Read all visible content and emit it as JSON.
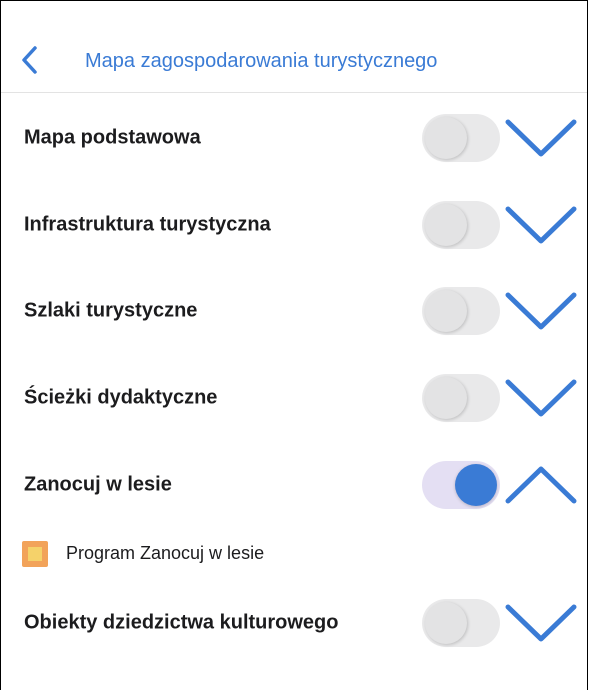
{
  "header": {
    "back_icon": "chevron-left-icon",
    "title": "Mapa zagospodarowania turystycznego"
  },
  "colors": {
    "accent": "#3a7bd5",
    "toggle_off_track": "#e9e9ea",
    "toggle_on_track": "#e4dff3",
    "legend_outer": "#f2a35a",
    "legend_inner": "#f5d26a"
  },
  "layers": [
    {
      "label": "Mapa podstawowa",
      "toggle_on": false,
      "expanded": false
    },
    {
      "label": "Infrastruktura turystyczna",
      "toggle_on": false,
      "expanded": false
    },
    {
      "label": "Szlaki turystyczne",
      "toggle_on": false,
      "expanded": false
    },
    {
      "label": "Ścieżki dydaktyczne",
      "toggle_on": false,
      "expanded": false
    },
    {
      "label": "Zanocuj w lesie",
      "toggle_on": true,
      "expanded": true
    },
    {
      "label": "Obiekty dziedzictwa kulturowego",
      "toggle_on": false,
      "expanded": false
    }
  ],
  "legend": {
    "items": [
      {
        "label": "Program Zanocuj w lesie"
      }
    ]
  }
}
